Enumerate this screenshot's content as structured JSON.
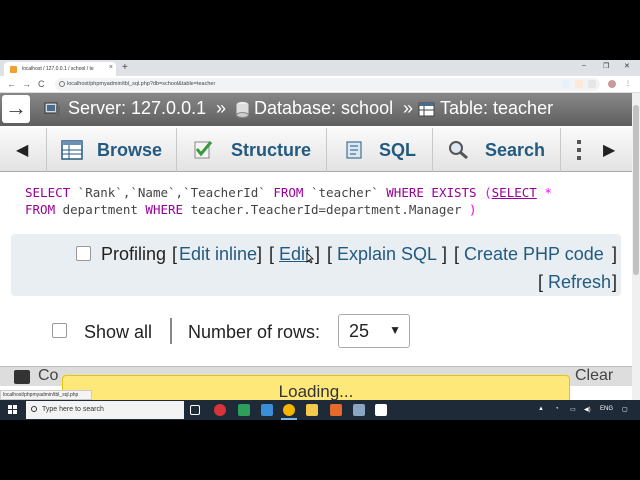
{
  "browser": {
    "tab_title": "localhost / 127.0.0.1 / school / te",
    "tab_close": "×",
    "new_tab": "+",
    "url": "localhost/phpmyadmin/tbl_sql.php?db=school&table=teacher",
    "window_controls": [
      "–",
      "❐",
      "✕"
    ],
    "back": "←",
    "forward": "→",
    "reload": "C",
    "status_url": "localhost/phpmyadmin/tbl_sql.php"
  },
  "breadcrumb": {
    "toggle_arrow": "→",
    "server": "Server: 127.0.0.1",
    "sep1": "»",
    "database": "Database: school",
    "sep2": "»",
    "table": "Table: teacher"
  },
  "tabs": {
    "scroll_left": "◀",
    "scroll_right": "▶",
    "items": [
      {
        "label": "Browse",
        "icon": "browse-icon"
      },
      {
        "label": "Structure",
        "icon": "structure-icon"
      },
      {
        "label": "SQL",
        "icon": "sql-icon"
      },
      {
        "label": "Search",
        "icon": "search-icon"
      }
    ]
  },
  "query": {
    "t1": "SELECT",
    "t2": " `Rank`,`Name`,`TeacherId` ",
    "t3": "FROM",
    "t4": " `teacher` ",
    "t5": "WHERE EXISTS",
    "t6": " (",
    "t7": "SELECT",
    "t8": " *",
    "t9": "FROM",
    "t10": " department ",
    "t11": "WHERE",
    "t12": " teacher.TeacherId=department.Manager ",
    "t13": ")"
  },
  "options": {
    "profiling": "Profiling",
    "edit_inline": "Edit inline",
    "edit": "Edit",
    "explain_sql": "Explain SQL",
    "create_php": "Create PHP code",
    "refresh": "Refresh",
    "lb": "[",
    "rb": "]"
  },
  "rows": {
    "show_all": "Show all",
    "number_of_rows_label": "Number of rows:",
    "number_of_rows_value": "25",
    "caret": "▼"
  },
  "console": {
    "label": "Co",
    "clear": "Clear",
    "loading": "Loading..."
  },
  "taskbar": {
    "search_placeholder": "Type here to search",
    "language": "ENG"
  },
  "colors": {
    "link": "#235a81",
    "keyword": "#990099",
    "loading_bg": "#ffe87a",
    "panel_bg": "#e8eef1"
  }
}
